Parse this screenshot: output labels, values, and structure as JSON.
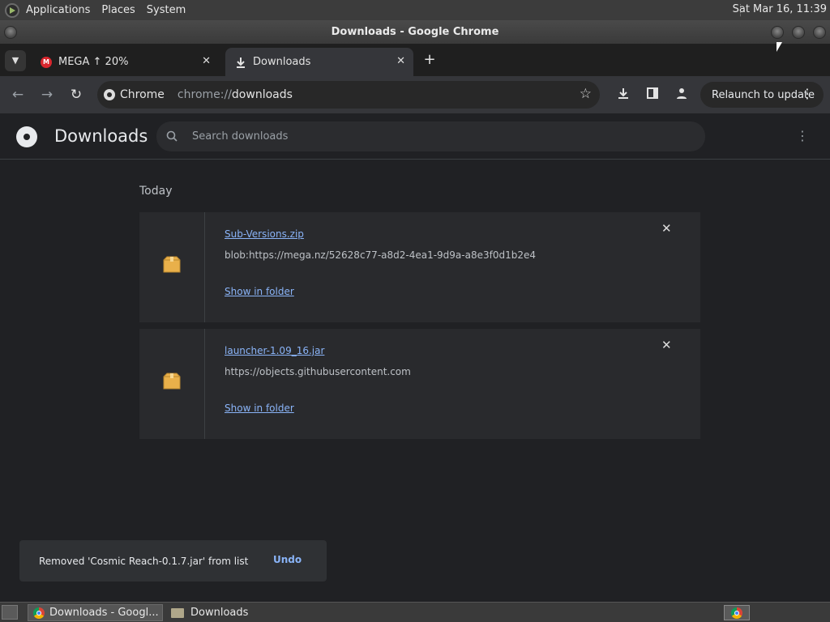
{
  "top_panel": {
    "menus": [
      "Applications",
      "Places",
      "System"
    ],
    "clock": "Sat Mar 16, 11:39"
  },
  "window": {
    "title": "Downloads - Google Chrome"
  },
  "tabs": [
    {
      "label": "MEGA ↑ 20%",
      "icon": "mega-icon",
      "active": false
    },
    {
      "label": "Downloads",
      "icon": "download-icon",
      "active": true
    }
  ],
  "toolbar": {
    "chip_label": "Chrome",
    "url_scheme": "chrome://",
    "url_host": "downloads",
    "relaunch_label": "Relaunch to update"
  },
  "downloads_page": {
    "title": "Downloads",
    "search_placeholder": "Search downloads",
    "section_label": "Today",
    "items": [
      {
        "filename": "Sub-Versions.zip",
        "source_url": "blob:https://mega.nz/52628c77-a8d2-4ea1-9d9a-a8e3f0d1b2e4",
        "action_label": "Show in folder",
        "icon": "package-icon"
      },
      {
        "filename": "launcher-1.09_16.jar",
        "source_url": "https://objects.githubusercontent.com",
        "action_label": "Show in folder",
        "icon": "package-icon"
      }
    ]
  },
  "toast": {
    "message": "Removed 'Cosmic Reach-0.1.7.jar' from list",
    "undo_label": "Undo"
  },
  "taskbar": {
    "items": [
      {
        "label": "Downloads - Googl...",
        "icon": "chrome-icon",
        "active": true
      },
      {
        "label": "Downloads",
        "icon": "folder-icon",
        "active": false
      }
    ]
  },
  "colors": {
    "background": "#202124",
    "link": "#8ab4f8",
    "card": "#292a2d"
  }
}
